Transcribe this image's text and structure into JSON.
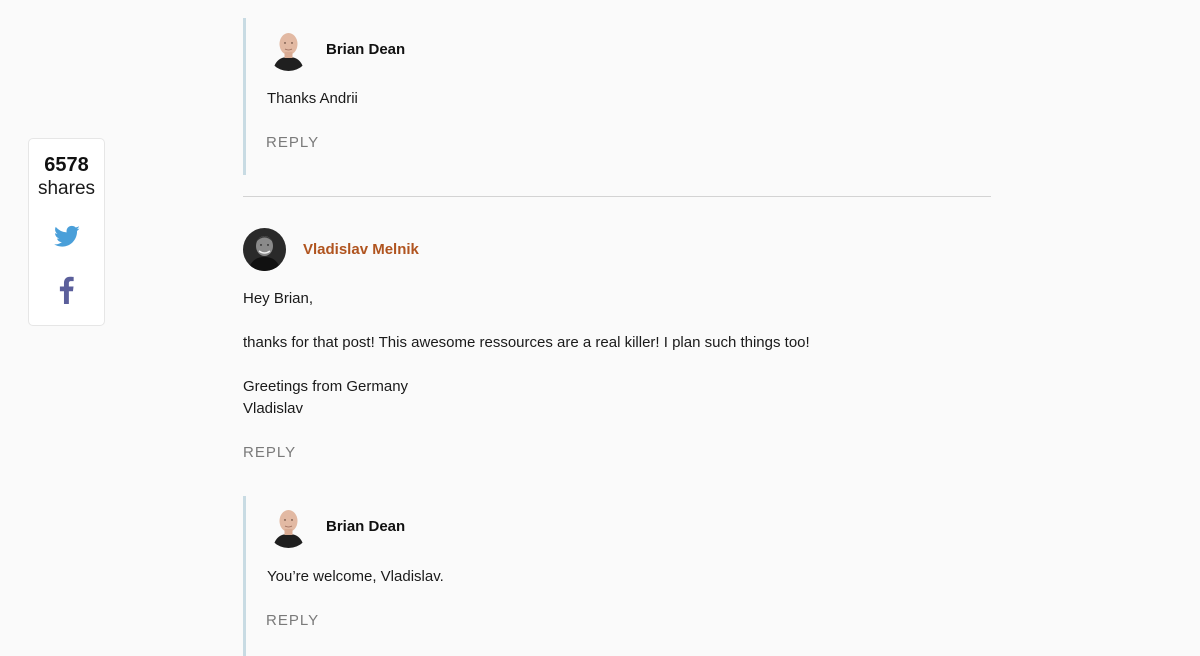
{
  "share_widget": {
    "count": "6578",
    "label": "shares",
    "twitter_icon": "twitter-icon",
    "facebook_icon": "facebook-icon",
    "twitter_color": "#4a9fd9",
    "facebook_color": "#5b5f9b"
  },
  "comments": [
    {
      "author": "Brian Dean",
      "lines": [
        "Thanks Andrii"
      ],
      "reply_label": "REPLY"
    },
    {
      "author": "Vladislav Melnik",
      "author_color": "#b0541f",
      "lines": [
        "Hey Brian,",
        "thanks for that post! This awesome ressources are a real killer! I plan such things too!",
        "Greetings from Germany",
        "Vladislav"
      ],
      "reply_label": "REPLY"
    },
    {
      "author": "Brian Dean",
      "lines": [
        "You’re welcome, Vladislav."
      ],
      "reply_label": "REPLY"
    }
  ],
  "colors": {
    "reply_border": "#c8dbe3",
    "divider": "#d3d3d3",
    "reply_text": "#7a7a7a"
  }
}
